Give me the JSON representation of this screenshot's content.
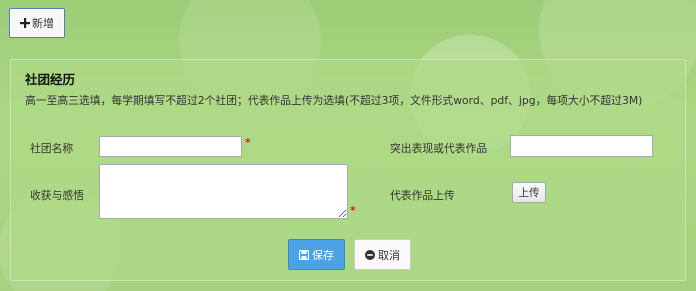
{
  "toolbar": {
    "add_label": "新增",
    "add_icon": "plus-icon"
  },
  "section": {
    "title": "社团经历",
    "description": "高一至高三选填，每学期填写不超过2个社团；代表作品上传为选填(不超过3项，文件形式word、pdf、jpg，每项大小不超过3M)"
  },
  "form": {
    "club_name": {
      "label": "社团名称",
      "value": "",
      "required": true
    },
    "gains": {
      "label": "收获与感悟",
      "value": "",
      "required": true
    },
    "highlight": {
      "label": "突出表现或代表作品",
      "value": ""
    },
    "upload": {
      "label": "代表作品上传",
      "button_label": "上传"
    },
    "required_mark": "*"
  },
  "actions": {
    "save_label": "保存",
    "save_icon": "floppy-disk-icon",
    "cancel_label": "取消",
    "cancel_icon": "minus-circle-icon"
  },
  "colors": {
    "background": "#a9d483",
    "save_button": "#4da1e6",
    "required": "#d9241c",
    "add_border": "#4a7fc0"
  }
}
